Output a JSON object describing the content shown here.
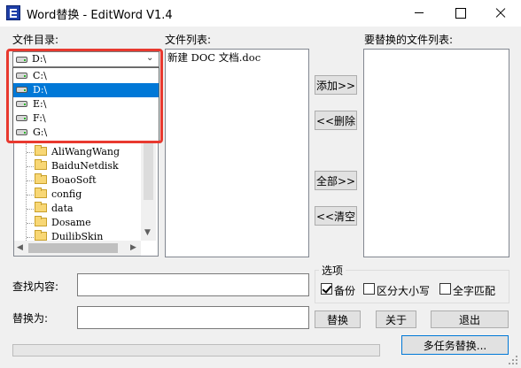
{
  "window": {
    "title": "Word替换 - EditWord V1.4"
  },
  "labels": {
    "dir_label": "文件目录:",
    "file_list_label": "文件列表:",
    "replace_list_label": "要替换的文件列表:",
    "find_label": "查找内容:",
    "replace_label": "替换为:",
    "options_title": "选项"
  },
  "drive_select": {
    "selected": "D:\\",
    "options": [
      {
        "label": "C:\\",
        "selected": false
      },
      {
        "label": "D:\\",
        "selected": true
      },
      {
        "label": "E:\\",
        "selected": false
      },
      {
        "label": "F:\\",
        "selected": false
      },
      {
        "label": "G:\\",
        "selected": false
      }
    ]
  },
  "tree": {
    "items": [
      "AliWangWang",
      "BaiduNetdisk",
      "BoaoSoft",
      "config",
      "data",
      "Dosame",
      "DuilibSkin"
    ]
  },
  "file_list": {
    "items": [
      "新建 DOC 文档.doc"
    ]
  },
  "buttons": {
    "add": "添加>>",
    "delete": "<<删除",
    "all": "全部>>",
    "clear": "<<清空",
    "replace": "替换",
    "about": "关于",
    "exit": "退出",
    "multi_task": "多任务替换..."
  },
  "inputs": {
    "find_value": "",
    "replace_value": ""
  },
  "options": {
    "backup": {
      "label": "备份",
      "checked": true
    },
    "case_sensitive": {
      "label": "区分大小写",
      "checked": false
    },
    "whole_word": {
      "label": "全字匹配",
      "checked": false
    }
  },
  "icons": {
    "app": "word-edit-icon",
    "folder": "folder-icon",
    "drive": "drive-icon"
  },
  "colors": {
    "selection": "#0078d7",
    "highlight_border": "#e8392f"
  }
}
